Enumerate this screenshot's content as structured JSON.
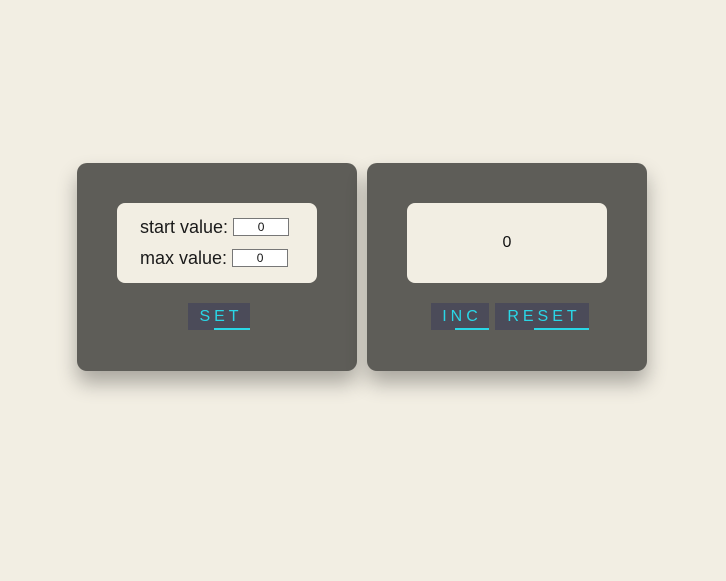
{
  "settings": {
    "start_label": "start value:",
    "start_value": "0",
    "max_label": "max value:",
    "max_value": "0",
    "set_label": "SET"
  },
  "counter": {
    "value": "0",
    "inc_label": "INC",
    "reset_label": "RESET"
  },
  "colors": {
    "background": "#f2eee3",
    "panel": "#5e5d58",
    "button": "#4b4b59",
    "accent": "#2ad6e6"
  }
}
